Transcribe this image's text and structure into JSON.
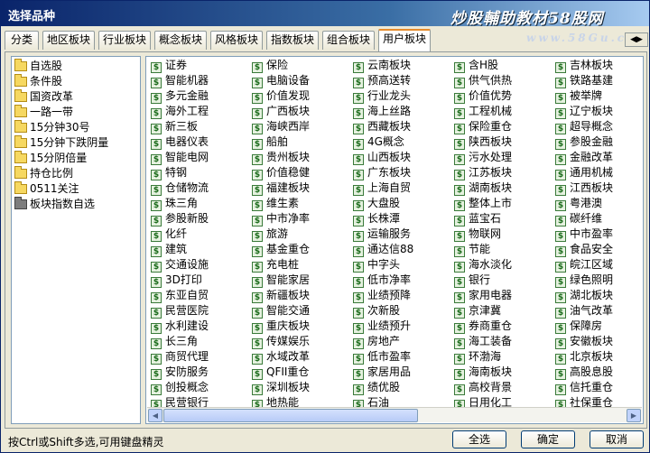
{
  "window": {
    "title": "选择品种",
    "watermark": "炒股輔助教材58股网",
    "watermark_url": "www.58Gu.com"
  },
  "tabs": [
    "分类",
    "地区板块",
    "行业板块",
    "概念板块",
    "风格板块",
    "指数板块",
    "组合板块",
    "用户板块"
  ],
  "active_tab": "用户板块",
  "tree": [
    "自选股",
    "条件股",
    "国资改革",
    "一路一带",
    "15分钟30号",
    "15分钟下跌阴量",
    "15分阴倍量",
    "持仓比例",
    "0511关注",
    "板块指数自选"
  ],
  "selected_tree": "板块指数自选",
  "columns": [
    [
      "证券",
      "智能机器",
      "多元金融",
      "海外工程",
      "新三板",
      "电器仪表",
      "智能电网",
      "特钢",
      "仓储物流",
      "珠三角",
      "参股新股",
      "化纤",
      "建筑",
      "交通设施",
      "3D打印",
      "东亚自贸",
      "民营医院",
      "水利建设",
      "长三角",
      "商贸代理",
      "安防服务",
      "创投概念",
      "民营银行"
    ],
    [
      "保险",
      "电脑设备",
      "价值发现",
      "广西板块",
      "海峡西岸",
      "船舶",
      "贵州板块",
      "价值稳健",
      "福建板块",
      "维生素",
      "中市净率",
      "旅游",
      "基金重仓",
      "充电桩",
      "智能家居",
      "新疆板块",
      "智能交通",
      "重庆板块",
      "传媒娱乐",
      "水域改革",
      "QFII重仓",
      "深圳板块",
      "地热能"
    ],
    [
      "云南板块",
      "预高送转",
      "行业龙头",
      "海上丝路",
      "西藏板块",
      "4G概念",
      "山西板块",
      "广东板块",
      "上海自贸",
      "大盘股",
      "长株潭",
      "运输服务",
      "通达信88",
      "中字头",
      "低市净率",
      "业绩预降",
      "次新股",
      "业绩预升",
      "房地产",
      "低市盈率",
      "家居用品",
      "绩优股",
      "石油"
    ],
    [
      "含H股",
      "供气供热",
      "价值优势",
      "工程机械",
      "保险重仓",
      "陕西板块",
      "污水处理",
      "江苏板块",
      "湖南板块",
      "整体上市",
      "蓝宝石",
      "物联网",
      "节能",
      "海水淡化",
      "银行",
      "家用电器",
      "京津冀",
      "券商重仓",
      "海工装备",
      "环渤海",
      "海南板块",
      "高校背景",
      "日用化工"
    ],
    [
      "吉林板块",
      "铁路基建",
      "被举牌",
      "辽宁板块",
      "超导概念",
      "参股金融",
      "金融改革",
      "通用机械",
      "江西板块",
      "粤港澳",
      "碳纤维",
      "中市盈率",
      "食品安全",
      "皖江区域",
      "绿色照明",
      "湖北板块",
      "油气改革",
      "保障房",
      "安徽板块",
      "北京板块",
      "高股息股",
      "信托重仓",
      "社保重仓"
    ]
  ],
  "item_icon": "stock-dollar-icon",
  "status_text": "按Ctrl或Shift多选,可用键盘精灵",
  "buttons": {
    "select_all": "全选",
    "ok": "确定",
    "cancel": "取消"
  }
}
